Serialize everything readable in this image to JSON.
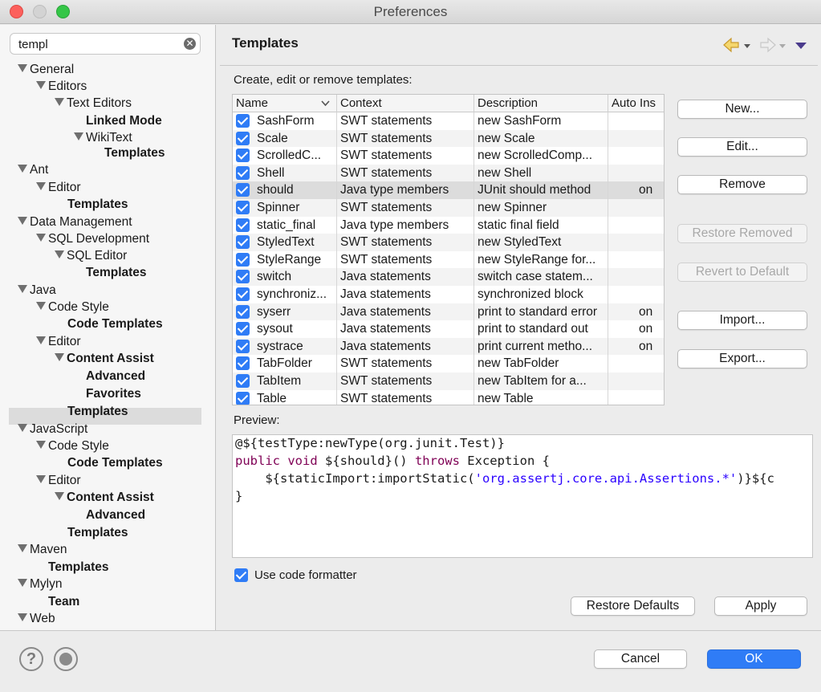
{
  "window": {
    "title": "Preferences"
  },
  "sidebar": {
    "filter_value": "templ",
    "tree": [
      {
        "label": "General",
        "level": 0,
        "expanded": true,
        "bold": false
      },
      {
        "label": "Editors",
        "level": 1,
        "expanded": true,
        "bold": false
      },
      {
        "label": "Text Editors",
        "level": 2,
        "expanded": true,
        "bold": false
      },
      {
        "label": "Linked Mode",
        "level": 3,
        "expanded": false,
        "bold": true
      },
      {
        "label": "WikiText",
        "level": 3,
        "expanded": true,
        "bold": false
      },
      {
        "label": "Templates",
        "level": 4,
        "expanded": false,
        "bold": true
      },
      {
        "label": "Ant",
        "level": 0,
        "expanded": true,
        "bold": false
      },
      {
        "label": "Editor",
        "level": 1,
        "expanded": true,
        "bold": false
      },
      {
        "label": "Templates",
        "level": 2,
        "expanded": false,
        "bold": true
      },
      {
        "label": "Data Management",
        "level": 0,
        "expanded": true,
        "bold": false
      },
      {
        "label": "SQL Development",
        "level": 1,
        "expanded": true,
        "bold": false
      },
      {
        "label": "SQL Editor",
        "level": 2,
        "expanded": true,
        "bold": false
      },
      {
        "label": "Templates",
        "level": 3,
        "expanded": false,
        "bold": true
      },
      {
        "label": "Java",
        "level": 0,
        "expanded": true,
        "bold": false
      },
      {
        "label": "Code Style",
        "level": 1,
        "expanded": true,
        "bold": false
      },
      {
        "label": "Code Templates",
        "level": 2,
        "expanded": false,
        "bold": true
      },
      {
        "label": "Editor",
        "level": 1,
        "expanded": true,
        "bold": false
      },
      {
        "label": "Content Assist",
        "level": 2,
        "expanded": true,
        "bold": true
      },
      {
        "label": "Advanced",
        "level": 3,
        "expanded": false,
        "bold": true
      },
      {
        "label": "Favorites",
        "level": 3,
        "expanded": false,
        "bold": true
      },
      {
        "label": "Templates",
        "level": 2,
        "expanded": false,
        "bold": true,
        "selected": true
      },
      {
        "label": "JavaScript",
        "level": 0,
        "expanded": true,
        "bold": false
      },
      {
        "label": "Code Style",
        "level": 1,
        "expanded": true,
        "bold": false
      },
      {
        "label": "Code Templates",
        "level": 2,
        "expanded": false,
        "bold": true
      },
      {
        "label": "Editor",
        "level": 1,
        "expanded": true,
        "bold": false
      },
      {
        "label": "Content Assist",
        "level": 2,
        "expanded": true,
        "bold": true
      },
      {
        "label": "Advanced",
        "level": 3,
        "expanded": false,
        "bold": true
      },
      {
        "label": "Templates",
        "level": 2,
        "expanded": false,
        "bold": true
      },
      {
        "label": "Maven",
        "level": 0,
        "expanded": true,
        "bold": false
      },
      {
        "label": "Templates",
        "level": 1,
        "expanded": false,
        "bold": true
      },
      {
        "label": "Mylyn",
        "level": 0,
        "expanded": true,
        "bold": false
      },
      {
        "label": "Team",
        "level": 1,
        "expanded": false,
        "bold": true
      },
      {
        "label": "Web",
        "level": 0,
        "expanded": true,
        "bold": false
      }
    ]
  },
  "main": {
    "heading": "Templates",
    "instructions": "Create, edit or remove templates:",
    "columns": [
      "Name",
      "Context",
      "Description",
      "Auto Ins"
    ],
    "rows": [
      {
        "name": "SashForm",
        "context": "SWT statements",
        "description": "new SashForm",
        "auto": ""
      },
      {
        "name": "Scale",
        "context": "SWT statements",
        "description": "new Scale",
        "auto": ""
      },
      {
        "name": "ScrolledC...",
        "context": "SWT statements",
        "description": "new ScrolledComp...",
        "auto": ""
      },
      {
        "name": "Shell",
        "context": "SWT statements",
        "description": "new Shell",
        "auto": ""
      },
      {
        "name": "should",
        "context": "Java type members",
        "description": "JUnit should method",
        "auto": "on",
        "selected": true
      },
      {
        "name": "Spinner",
        "context": "SWT statements",
        "description": "new Spinner",
        "auto": ""
      },
      {
        "name": "static_final",
        "context": "Java type members",
        "description": "static final field",
        "auto": ""
      },
      {
        "name": "StyledText",
        "context": "SWT statements",
        "description": "new StyledText",
        "auto": ""
      },
      {
        "name": "StyleRange",
        "context": "SWT statements",
        "description": "new StyleRange for...",
        "auto": ""
      },
      {
        "name": "switch",
        "context": "Java statements",
        "description": "switch case statem...",
        "auto": ""
      },
      {
        "name": "synchroniz...",
        "context": "Java statements",
        "description": "synchronized block",
        "auto": ""
      },
      {
        "name": "syserr",
        "context": "Java statements",
        "description": "print to standard error",
        "auto": "on"
      },
      {
        "name": "sysout",
        "context": "Java statements",
        "description": "print to standard out",
        "auto": "on"
      },
      {
        "name": "systrace",
        "context": "Java statements",
        "description": "print current metho...",
        "auto": "on"
      },
      {
        "name": "TabFolder",
        "context": "SWT statements",
        "description": "new TabFolder",
        "auto": ""
      },
      {
        "name": "TabItem",
        "context": "SWT statements",
        "description": "new TabItem for a...",
        "auto": ""
      },
      {
        "name": "Table",
        "context": "SWT statements",
        "description": "new Table",
        "auto": ""
      }
    ],
    "buttons": {
      "new": "New...",
      "edit": "Edit...",
      "remove": "Remove",
      "restore_removed": "Restore Removed",
      "revert_default": "Revert to Default",
      "import": "Import...",
      "export": "Export..."
    },
    "preview_label": "Preview:",
    "preview": {
      "line1": "@${testType:newType(org.junit.Test)}",
      "line2_kw1": "public void ",
      "line2_mid": "${should}() ",
      "line2_kw2": "throws",
      "line2_end": " Exception {",
      "line3_pre": "    ${staticImport:importStatic(",
      "line3_str": "'org.assertj.core.api.Assertions.*'",
      "line3_post": ")}${c",
      "line4": "}"
    },
    "use_formatter_label": "Use code formatter",
    "restore_defaults": "Restore Defaults",
    "apply": "Apply"
  },
  "footer": {
    "help_icon": "?",
    "cancel": "Cancel",
    "ok": "OK"
  }
}
